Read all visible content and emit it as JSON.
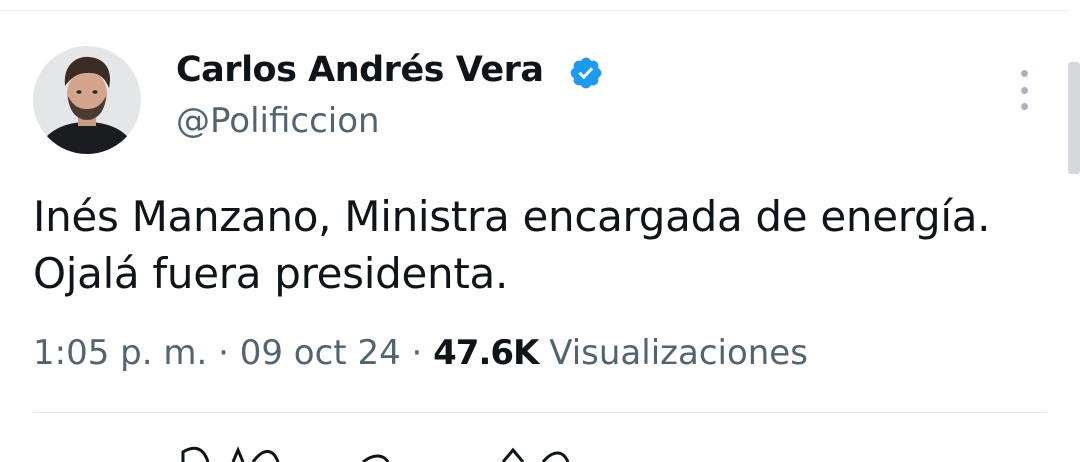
{
  "author": {
    "display_name": "Carlos Andrés Vera",
    "handle": "@Polificcion",
    "verified": true,
    "verified_color": "#1d9bf0"
  },
  "tweet": {
    "text": "Inés Manzano, Ministra encargada de energía. Ojalá fuera presidenta."
  },
  "meta": {
    "time": "1:05 p. m.",
    "separator": "·",
    "date": "09 oct 24",
    "views_count": "47.6K",
    "views_label": "Visualizaciones"
  },
  "icons": {
    "more": "more-vertical-icon",
    "verified": "verified-badge-icon"
  }
}
